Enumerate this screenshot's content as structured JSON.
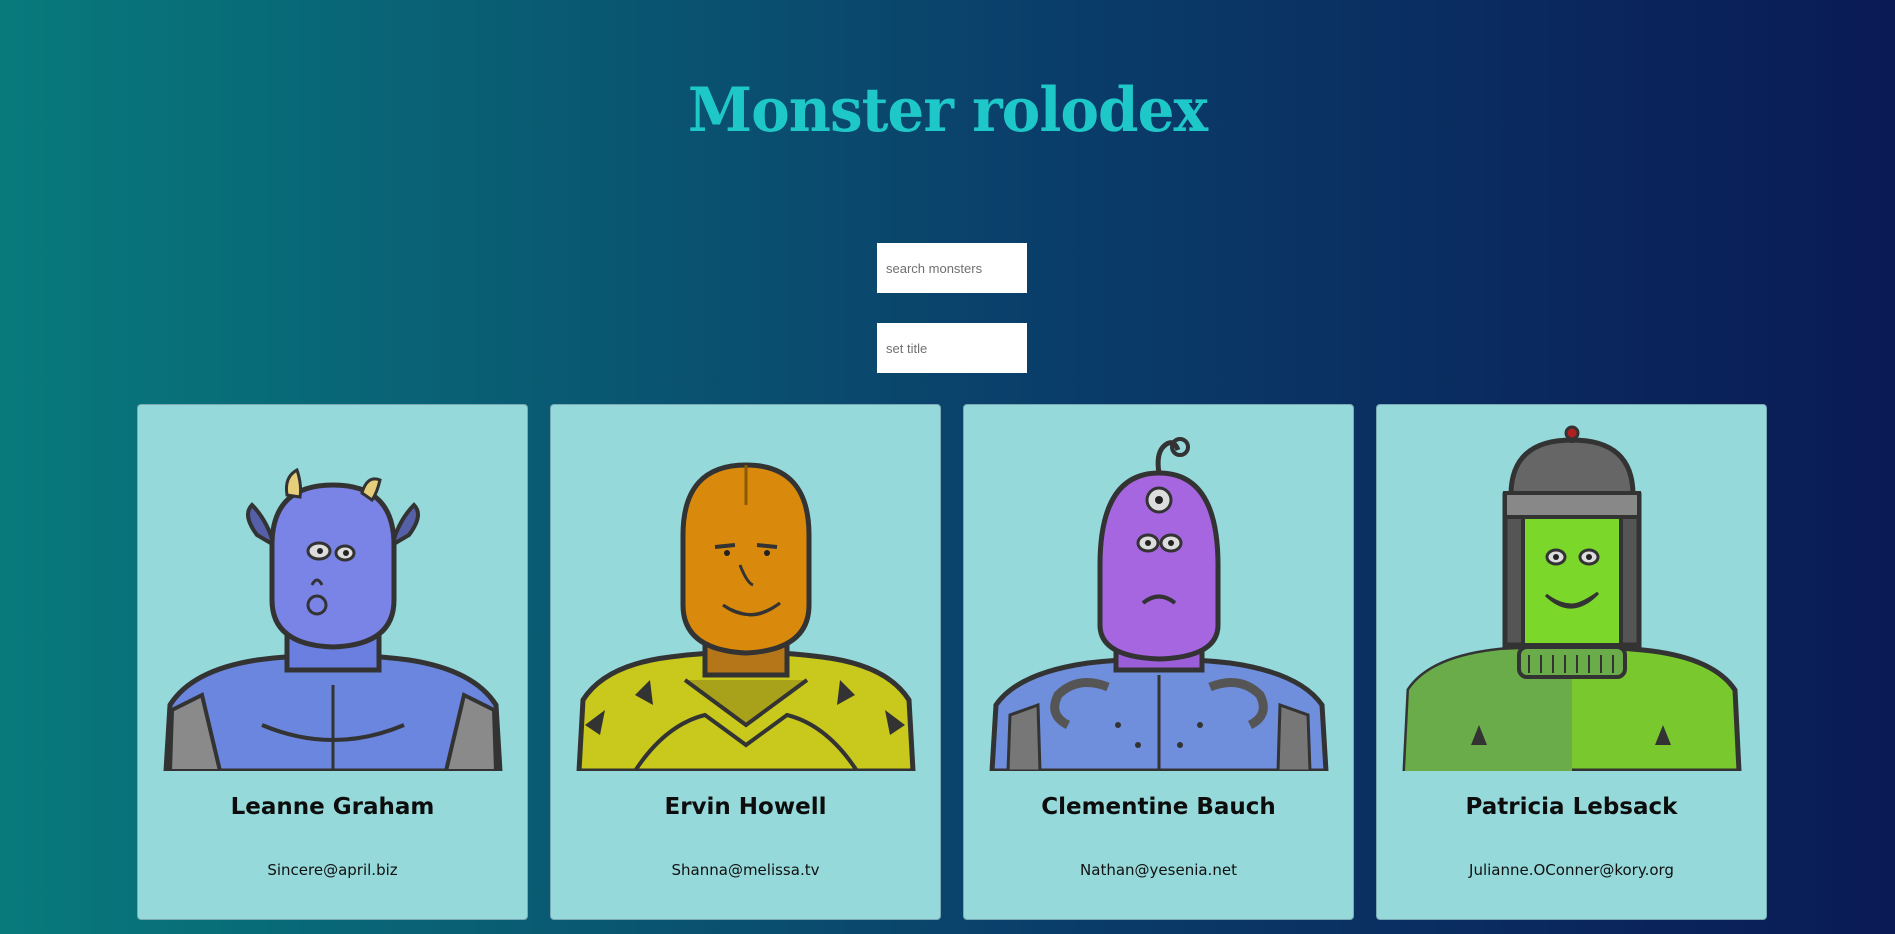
{
  "header": {
    "title": "Monster rolodex",
    "title_color": "#1fc8c8"
  },
  "search": {
    "monsters_placeholder": "search monsters",
    "title_placeholder": "set title"
  },
  "monsters": [
    {
      "name": "Leanne Graham",
      "email": "Sincere@april.biz",
      "skin_color": "#7a83e6",
      "body_color": "#6a86de"
    },
    {
      "name": "Ervin Howell",
      "email": "Shanna@melissa.tv",
      "skin_color": "#d98a0c",
      "body_color": "#c9c81c"
    },
    {
      "name": "Clementine Bauch",
      "email": "Nathan@yesenia.net",
      "skin_color": "#a566e0",
      "body_color": "#6f8fdc"
    },
    {
      "name": "Patricia Lebsack",
      "email": "Julianne.OConner@kory.org",
      "skin_color": "#7cd72b",
      "body_color": "#78c82e"
    }
  ],
  "theme": {
    "card_background": "#95d9da",
    "gradient_left": "#087a7c",
    "gradient_right": "#0a1a55"
  }
}
